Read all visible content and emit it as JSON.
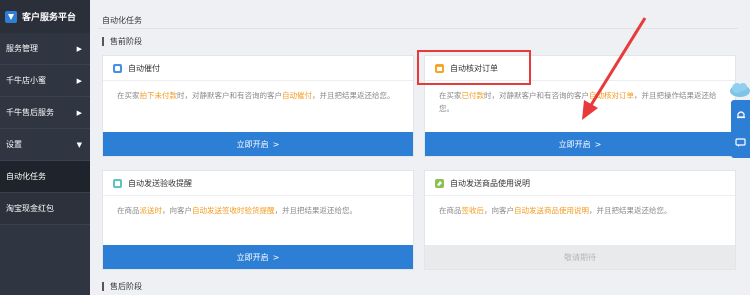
{
  "brand": {
    "name": "客户服务平台"
  },
  "sidebar": {
    "items": [
      {
        "label": "服务管理",
        "arrow": "▶"
      },
      {
        "label": "千牛店小蜜",
        "arrow": "▶"
      },
      {
        "label": "千牛售后服务",
        "arrow": "▶"
      },
      {
        "label": "设置",
        "arrow": "▼"
      },
      {
        "label": "自动化任务",
        "arrow": ""
      },
      {
        "label": "淘宝现金红包",
        "arrow": ""
      }
    ]
  },
  "page": {
    "title": "自动化任务",
    "section_pre": "售前阶段",
    "section_after": "售后阶段"
  },
  "cards": [
    {
      "title": "自动催付",
      "desc": [
        "在买家",
        "拍下未付款",
        "时，对静默客户和有咨询的客户",
        "自动催付",
        "，并且把结果返还给您。"
      ],
      "button": "立即开启",
      "chev": ">"
    },
    {
      "title": "自动核对订单",
      "desc": [
        "在买家",
        "已付款",
        "时，对静默客户和有咨询的客户",
        "自动核对订单",
        "，并且把操作结果返还给您。"
      ],
      "button": "立即开启",
      "chev": ">"
    },
    {
      "title": "自动发送验收提醒",
      "desc": [
        "在商品",
        "派送时",
        "，向客户",
        "自动发送签收时验货提醒",
        "，并且把结果返还给您。"
      ],
      "button": "立即开启",
      "chev": ">"
    },
    {
      "title": "自动发送商品使用说明",
      "desc": [
        "在商品",
        "签收后",
        "，向客户",
        "自动发送商品使用说明",
        "，并且把结果返还给您。"
      ],
      "button": "敬请期待",
      "chev": ""
    }
  ],
  "colors": {
    "accent": "#2d7fd6",
    "highlight_text": "#f39a1e",
    "annotation": "#e83a3a",
    "sidebar": "#2f3541"
  }
}
